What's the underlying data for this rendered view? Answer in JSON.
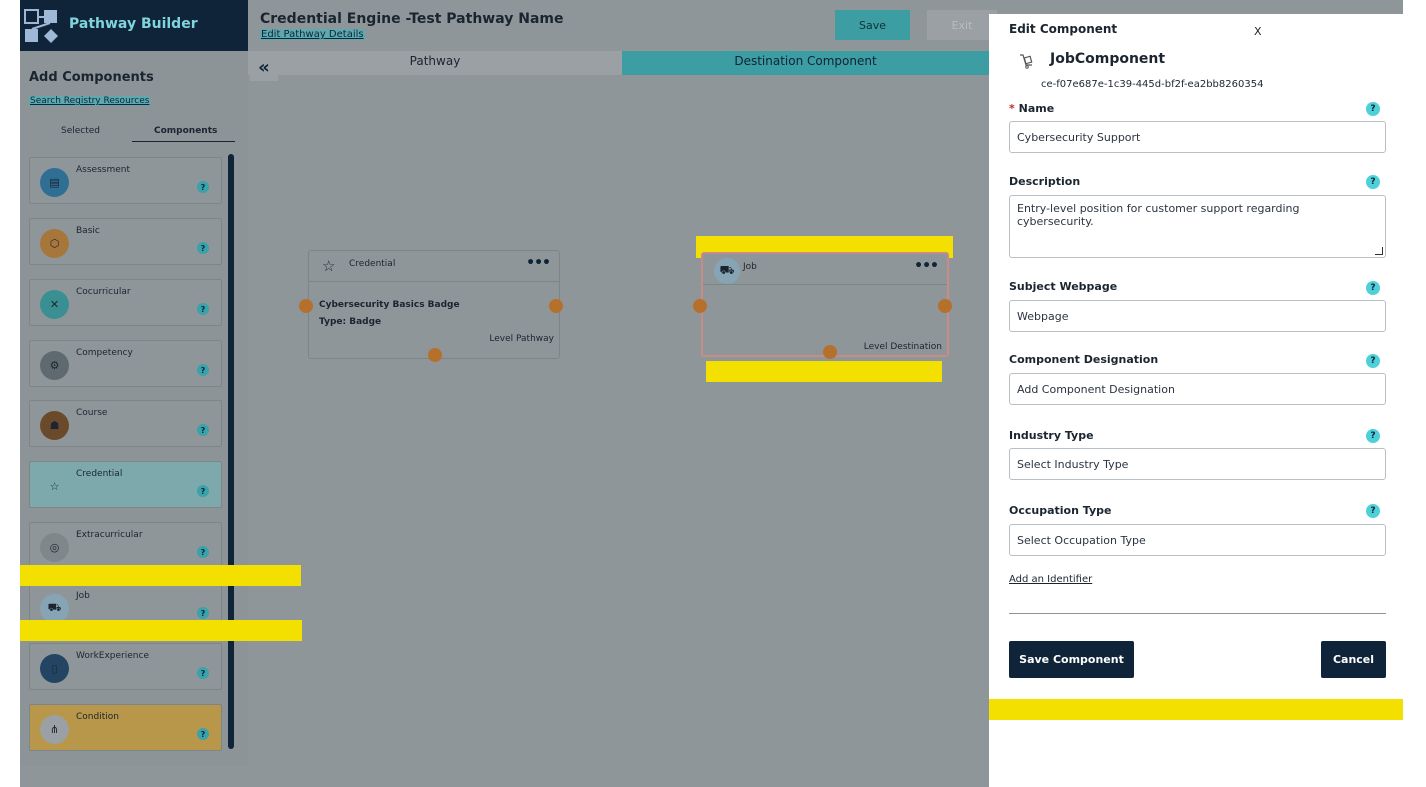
{
  "app": {
    "brand": "Pathway Builder"
  },
  "header": {
    "title": "Credential Engine -Test Pathway Name",
    "edit_link": "Edit Pathway Details",
    "save_label": "Save",
    "exit_label": "Exit"
  },
  "sidebar": {
    "heading": "Add Components",
    "search_link": "Search Registry Resources",
    "tabs": [
      "Selected",
      "Components"
    ],
    "active_tab": "Components",
    "items": [
      {
        "label": "Assessment",
        "icon": "assessment-icon",
        "color": "#2f6f93"
      },
      {
        "label": "Basic",
        "icon": "cube-icon",
        "color": "#a7763a"
      },
      {
        "label": "Cocurricular",
        "icon": "cocurricular-icon",
        "color": "#3a8f92"
      },
      {
        "label": "Competency",
        "icon": "gear-icon",
        "color": "#5f6a70"
      },
      {
        "label": "Course",
        "icon": "course-icon",
        "color": "#6b4a2c"
      },
      {
        "label": "Credential",
        "icon": "star-icon",
        "color": "#7da9ac"
      },
      {
        "label": "Extracurricular",
        "icon": "extracurricular-icon",
        "color": "#7f878b"
      },
      {
        "label": "Job",
        "icon": "job-icon",
        "color": "#86a4b3"
      },
      {
        "label": "WorkExperience",
        "icon": "work-experience-icon",
        "color": "#234563"
      },
      {
        "label": "Condition",
        "icon": "condition-icon",
        "color": "#9aa0a4"
      }
    ],
    "help": "?"
  },
  "canvas": {
    "pathway_title": "Pathway",
    "destination_title": "Destination Component",
    "collapse_icon": "«",
    "credential_node": {
      "type_label": "Credential",
      "name": "Cybersecurity Basics Badge",
      "type_line": "Type: Badge",
      "level": "Level Pathway",
      "menu": "•••"
    },
    "job_node": {
      "type_label": "Job",
      "level": "Level Destination",
      "menu": "•••"
    }
  },
  "panel": {
    "title": "Edit Component",
    "close": "X",
    "component_name": "JobComponent",
    "component_id": "ce-f07e687e-1c39-445d-bf2f-ea2bb8260354",
    "fields": {
      "name": {
        "label": "Name",
        "required": "*",
        "value": "Cybersecurity Support"
      },
      "description": {
        "label": "Description",
        "value": "Entry-level position for customer support  regarding cybersecurity."
      },
      "subject_webpage": {
        "label": "Subject Webpage",
        "placeholder": "Webpage"
      },
      "designation": {
        "label": "Component Designation",
        "placeholder": "Add Component Designation"
      },
      "industry": {
        "label": "Industry Type",
        "placeholder": "Select Industry Type"
      },
      "occupation": {
        "label": "Occupation Type",
        "placeholder": "Select Occupation Type"
      }
    },
    "help": "?",
    "add_identifier": "Add an Identifier",
    "save_button": "Save Component",
    "cancel_button": "Cancel"
  },
  "colors": {
    "navy": "#0f2438",
    "teal": "#3c9da2",
    "highlight": "#f4e000",
    "port": "#b5702c"
  }
}
